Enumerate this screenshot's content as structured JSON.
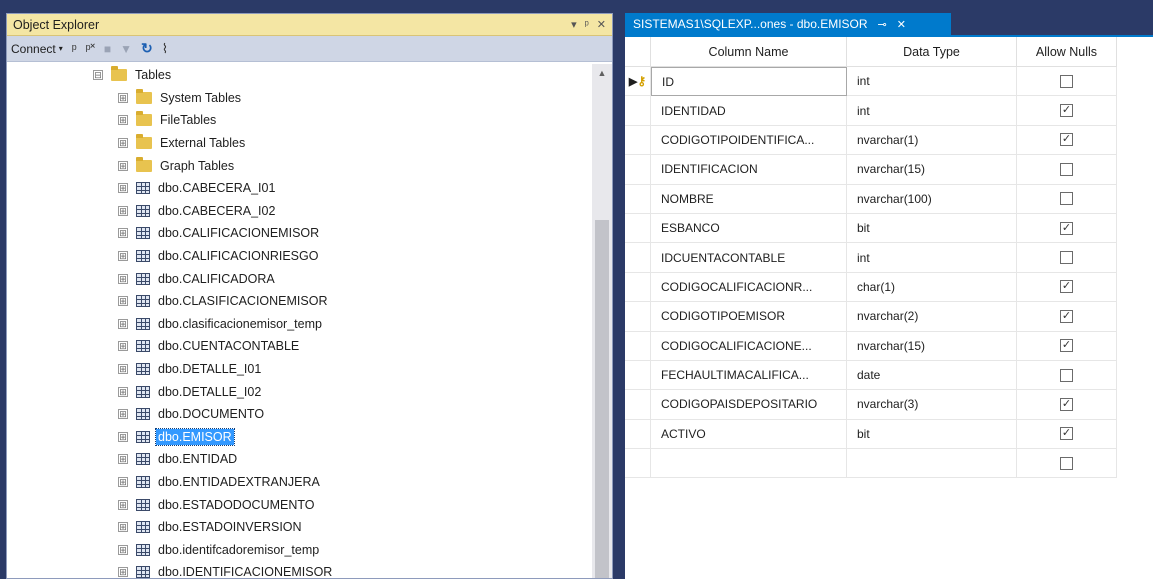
{
  "object_explorer": {
    "title": "Object Explorer",
    "controls": {
      "dropdown": "▾",
      "pin": "ᵖ",
      "close": "✕"
    },
    "toolbar": {
      "connect_label": "Connect",
      "connect_caret": "▾",
      "icons": {
        "connect": "ᵖ",
        "disconnect": "ᵖ˟",
        "stop": "■",
        "filter": "▼",
        "refresh": "↻",
        "activity": "⌇"
      }
    },
    "tree": {
      "root": "Tables",
      "folders": [
        "System Tables",
        "FileTables",
        "External Tables",
        "Graph Tables"
      ],
      "tables": [
        "dbo.CABECERA_I01",
        "dbo.CABECERA_I02",
        "dbo.CALIFICACIONEMISOR",
        "dbo.CALIFICACIONRIESGO",
        "dbo.CALIFICADORA",
        "dbo.CLASIFICACIONEMISOR",
        "dbo.clasificacionemisor_temp",
        "dbo.CUENTACONTABLE",
        "dbo.DETALLE_I01",
        "dbo.DETALLE_I02",
        "dbo.DOCUMENTO",
        "dbo.EMISOR",
        "dbo.ENTIDAD",
        "dbo.ENTIDADEXTRANJERA",
        "dbo.ESTADODOCUMENTO",
        "dbo.ESTADOINVERSION",
        "dbo.identifcadoremisor_temp",
        "dbo.IDENTIFICACIONEMISOR"
      ],
      "selected": "dbo.EMISOR",
      "expanded_glyph": "⊟",
      "collapsed_glyph": "⊞"
    }
  },
  "designer": {
    "tab_title": "SISTEMAS1\\SQLEXP...ones - dbo.EMISOR",
    "tab_pin": "⊸",
    "tab_close": "✕",
    "headers": [
      "Column Name",
      "Data Type",
      "Allow Nulls"
    ],
    "rows": [
      {
        "name": "ID",
        "type": "int",
        "nulls": false,
        "pk": true
      },
      {
        "name": "IDENTIDAD",
        "type": "int",
        "nulls": true
      },
      {
        "name": "CODIGOTIPOIDENTIFICA...",
        "type": "nvarchar(1)",
        "nulls": true
      },
      {
        "name": "IDENTIFICACION",
        "type": "nvarchar(15)",
        "nulls": false
      },
      {
        "name": "NOMBRE",
        "type": "nvarchar(100)",
        "nulls": false
      },
      {
        "name": "ESBANCO",
        "type": "bit",
        "nulls": true
      },
      {
        "name": "IDCUENTACONTABLE",
        "type": "int",
        "nulls": false
      },
      {
        "name": "CODIGOCALIFICACIONR...",
        "type": "char(1)",
        "nulls": true
      },
      {
        "name": "CODIGOTIPOEMISOR",
        "type": "nvarchar(2)",
        "nulls": true
      },
      {
        "name": "CODIGOCALIFICACIONE...",
        "type": "nvarchar(15)",
        "nulls": true
      },
      {
        "name": "FECHAULTIMACALIFICA...",
        "type": "date",
        "nulls": false
      },
      {
        "name": "CODIGOPAISDEPOSITARIO",
        "type": "nvarchar(3)",
        "nulls": true
      },
      {
        "name": "ACTIVO",
        "type": "bit",
        "nulls": true
      },
      {
        "name": "",
        "type": "",
        "nulls": false
      }
    ],
    "row_selector": "▶",
    "key_icon": "⚷",
    "check_glyph": "✓"
  },
  "colors": {
    "tab_active": "#007acc",
    "oe_title_bg": "#f4e6a4",
    "selection": "#3399ff",
    "frame_bg": "#2b3a67"
  }
}
